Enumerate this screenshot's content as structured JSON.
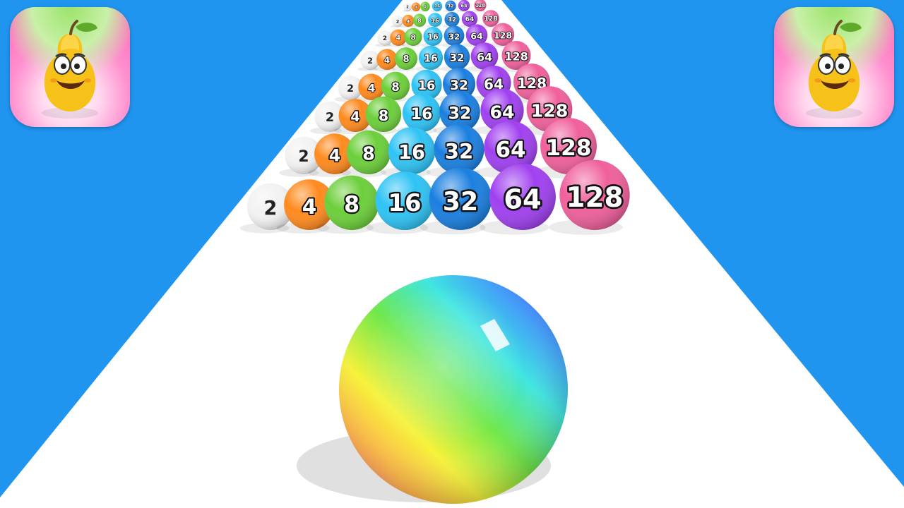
{
  "game": {
    "ball_rows": [
      {
        "values": [
          "2",
          "4",
          "8",
          "16",
          "32",
          "64",
          "128"
        ]
      },
      {
        "values": [
          "2",
          "4",
          "8",
          "16",
          "32",
          "64",
          "128"
        ]
      },
      {
        "values": [
          "2",
          "4",
          "8",
          "16",
          "32",
          "64",
          "128"
        ]
      },
      {
        "values": [
          "2",
          "4",
          "8",
          "16",
          "32",
          "64",
          "128"
        ]
      },
      {
        "values": [
          "2",
          "4",
          "8",
          "16",
          "32",
          "64",
          "128"
        ]
      },
      {
        "values": [
          "2",
          "4",
          "8",
          "16",
          "32",
          "64",
          "128"
        ]
      },
      {
        "values": [
          "2",
          "4",
          "8",
          "16",
          "32",
          "64",
          "128"
        ]
      },
      {
        "values": [
          "2",
          "4",
          "8",
          "16",
          "32",
          "64",
          "128"
        ]
      }
    ],
    "ball_colors": {
      "2": "#f2f2f2",
      "4": "#ff8a1e",
      "8": "#6ccf3a",
      "16": "#2ec3f5",
      "32": "#1a7fe0",
      "64": "#a040f0",
      "128": "#f0609c"
    },
    "player_ball": {
      "style": "rainbow"
    },
    "track_color": "#ffffff",
    "background_color": "#1f95f0"
  },
  "icons": {
    "left": "pear-app-icon",
    "right": "pear-app-icon"
  }
}
